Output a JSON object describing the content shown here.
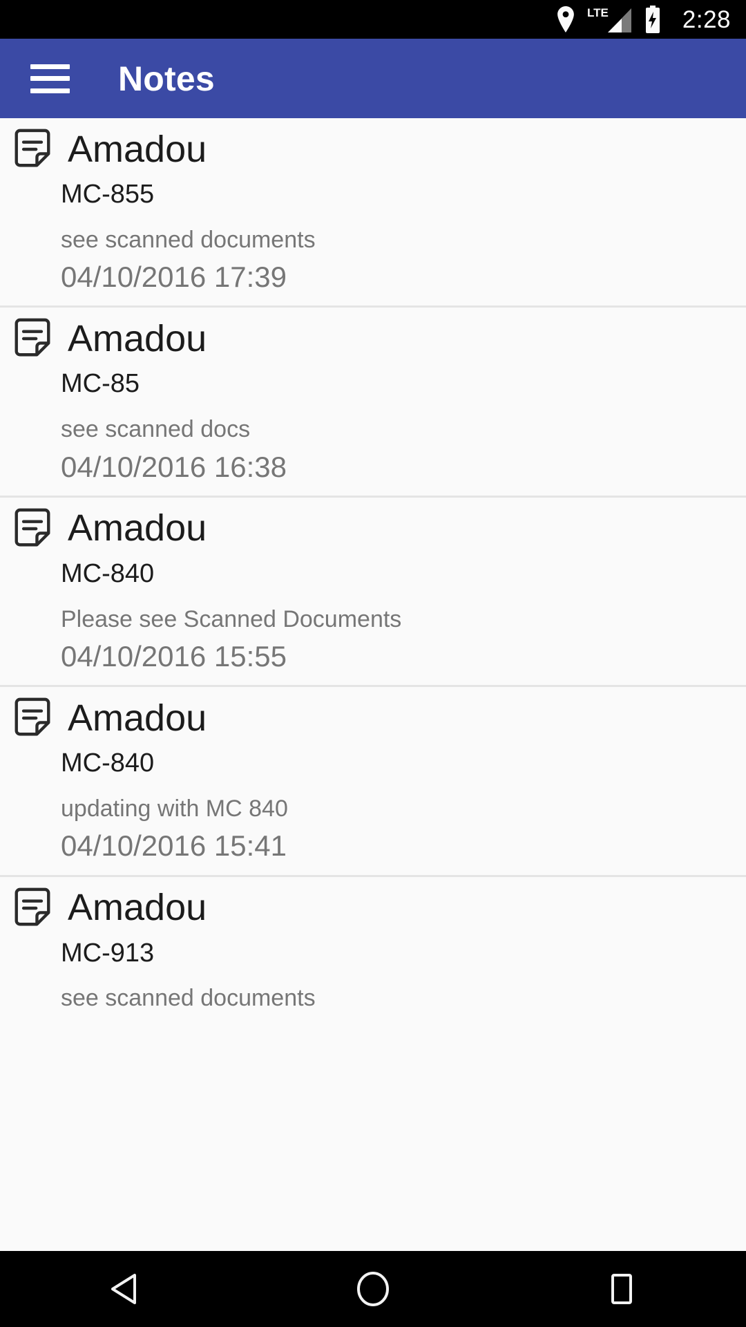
{
  "status_bar": {
    "icons": [
      "location-pin-icon",
      "lte-label",
      "signal-bars-icon",
      "battery-charging-icon"
    ],
    "lte_label": "LTE",
    "time": "2:28"
  },
  "app_bar": {
    "menu_icon": "hamburger-menu-icon",
    "title": "Notes",
    "background_color": "#3b4aa5",
    "text_color": "#ffffff"
  },
  "notes": [
    {
      "icon": "note-icon",
      "title": "Amadou",
      "subtitle": "MC-855",
      "body": "see scanned documents",
      "date": "04/10/2016 17:39"
    },
    {
      "icon": "note-icon",
      "title": "Amadou",
      "subtitle": "MC-85",
      "body": "see scanned docs",
      "date": "04/10/2016 16:38"
    },
    {
      "icon": "note-icon",
      "title": "Amadou",
      "subtitle": "MC-840",
      "body": "Please see Scanned Documents",
      "date": "04/10/2016 15:55"
    },
    {
      "icon": "note-icon",
      "title": "Amadou",
      "subtitle": "MC-840",
      "body": "updating with MC 840",
      "date": "04/10/2016 15:41"
    },
    {
      "icon": "note-icon",
      "title": "Amadou",
      "subtitle": "MC-913",
      "body": "see scanned documents",
      "date": ""
    }
  ],
  "nav_bar": {
    "back_icon": "back-triangle-icon",
    "home_icon": "home-circle-icon",
    "recents_icon": "recents-square-icon"
  },
  "colors": {
    "accent": "#3b4aa5",
    "list_background": "#fafafa",
    "divider": "#e4e4e4",
    "primary_text": "#1c1c1c",
    "secondary_text": "#767676",
    "system_bar": "#000000"
  }
}
